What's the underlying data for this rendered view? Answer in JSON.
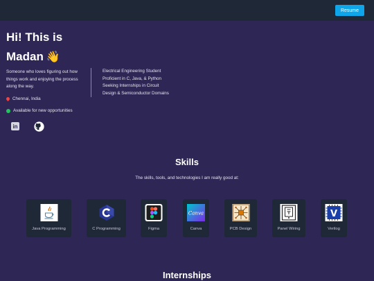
{
  "header": {
    "resume_label": "Resume"
  },
  "hero": {
    "title_line1": "Hi! This is",
    "title_line2": "Madan",
    "wave": "👋",
    "bio": "Someone who loves figuring out how things work and enjoying the process along the way.",
    "location": "Chennai, India",
    "availability": "Available for new opportunities",
    "social": {
      "linkedin": "in"
    },
    "details": [
      "Electrical Engineering Student",
      "Proficient in C, Java, & Python",
      "Seeking Internships in Circuit",
      "Design & Semiconductor Domains"
    ]
  },
  "skills": {
    "title": "Skills",
    "subtitle": "The skills, tools, and technologies I am really good at:",
    "items": [
      {
        "label": "Java Programming",
        "icon": "java-icon"
      },
      {
        "label": "C Programming",
        "icon": "c-language-icon"
      },
      {
        "label": "Figma",
        "icon": "figma-icon"
      },
      {
        "label": "Canva",
        "icon": "canva-icon",
        "logo_text": "Canva"
      },
      {
        "label": "PCB Design",
        "icon": "pcb-icon"
      },
      {
        "label": "Panel Wiring",
        "icon": "panel-wiring-icon"
      },
      {
        "label": "Verilog",
        "icon": "verilog-icon",
        "logo_text": "V"
      }
    ]
  },
  "internships": {
    "title": "Internships"
  },
  "colors": {
    "background": "#2e2654",
    "topbar": "#1e2837",
    "accent": "#0ea5e9",
    "card": "#1e2837"
  }
}
